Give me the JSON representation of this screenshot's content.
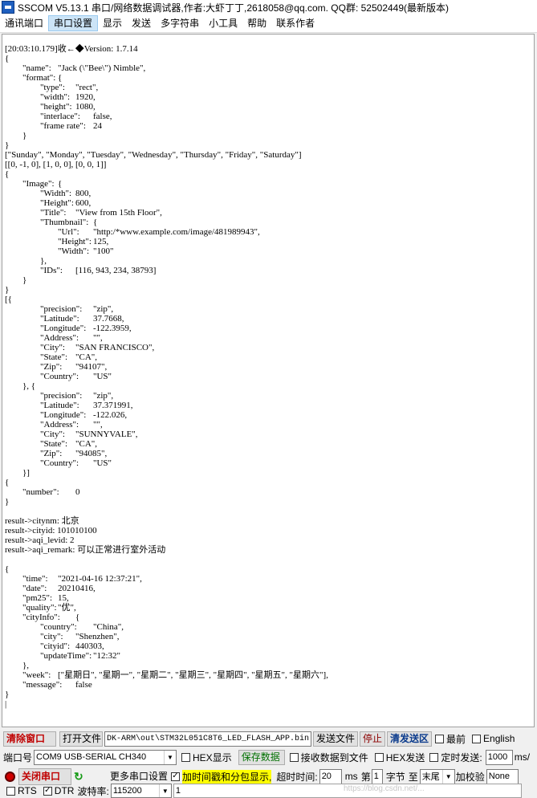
{
  "window": {
    "title": "SSCOM V5.13.1 串口/网络数据调试器,作者:大虾丁丁,2618058@qq.com. QQ群: 52502449(最新版本)"
  },
  "menu": [
    "通讯端口",
    "串口设置",
    "显示",
    "发送",
    "多字符串",
    "小工具",
    "帮助",
    "联系作者"
  ],
  "terminal": {
    "text": "[20:03:10.179]收←◆Version: 1.7.14\n{\n\t\"name\":\t\"Jack (\\\"Bee\\\") Nimble\",\n\t\"format\":\t{\n\t\t\"type\":\t\"rect\",\n\t\t\"width\":\t1920,\n\t\t\"height\":\t1080,\n\t\t\"interlace\":\tfalse,\n\t\t\"frame rate\":\t24\n\t}\n}\n[\"Sunday\", \"Monday\", \"Tuesday\", \"Wednesday\", \"Thursday\", \"Friday\", \"Saturday\"]\n[[0, -1, 0], [1, 0, 0], [0, 0, 1]]\n{\n\t\"Image\":\t{\n\t\t\"Width\":\t800,\n\t\t\"Height\":\t600,\n\t\t\"Title\":\t\"View from 15th Floor\",\n\t\t\"Thumbnail\":\t{\n\t\t\t\"Url\":\t\"http:/*www.example.com/image/481989943\",\n\t\t\t\"Height\":\t125,\n\t\t\t\"Width\":\t\"100\"\n\t\t},\n\t\t\"IDs\":\t[116, 943, 234, 38793]\n\t}\n}\n[{\n\t\t\"precision\":\t\"zip\",\n\t\t\"Latitude\":\t37.7668,\n\t\t\"Longitude\":\t-122.3959,\n\t\t\"Address\":\t\"\",\n\t\t\"City\":\t\"SAN FRANCISCO\",\n\t\t\"State\":\t\"CA\",\n\t\t\"Zip\":\t\"94107\",\n\t\t\"Country\":\t\"US\"\n\t}, {\n\t\t\"precision\":\t\"zip\",\n\t\t\"Latitude\":\t37.371991,\n\t\t\"Longitude\":\t-122.026,\n\t\t\"Address\":\t\"\",\n\t\t\"City\":\t\"SUNNYVALE\",\n\t\t\"State\":\t\"CA\",\n\t\t\"Zip\":\t\"94085\",\n\t\t\"Country\":\t\"US\"\n\t}]\n{\n\t\"number\":\t0\n}\n\nresult->citynm: 北京\nresult->cityid: 101010100\nresult->aqi_levid: 2\nresult->aqi_remark: 可以正常进行室外活动\n\n{\n\t\"time\":\t\"2021-04-16 12:37:21\",\n\t\"date\":\t20210416,\n\t\"pm25\":\t15,\n\t\"quality\":\t\"优\",\n\t\"cityInfo\":\t{\n\t\t\"country\":\t\"China\",\n\t\t\"city\":\t\"Shenzhen\",\n\t\t\"cityid\":\t440303,\n\t\t\"updateTime\":\t\"12:32\"\n\t},\n\t\"week\":\t[\"星期日\", \"星期一\", \"星期二\", \"星期三\", \"星期四\", \"星期五\", \"星期六\"],\n\t\"message\":\tfalse\n}\n|"
  },
  "toolbar1": {
    "clear_label": "清除窗口",
    "open_file_label": "打开文件",
    "file_path": "DK-ARM\\out\\STM32L051C8T6_LED_FLASH_APP.bin",
    "send_file_label": "发送文件",
    "stop_label": "停止",
    "clear_send_label": "清发送区",
    "topmost_label": "最前",
    "english_label": "English"
  },
  "toolbar2": {
    "port_label": "端口号",
    "port_value": "COM9 USB-SERIAL CH340",
    "hex_display_label": "HEX显示",
    "save_data_label": "保存数据",
    "receive_to_file_label": "接收数据到文件",
    "hex_send_label": "HEX发送",
    "timed_send_label": "定时发送:",
    "interval_value": "1000",
    "interval_unit": "ms/"
  },
  "toolbar3": {
    "close_port_label": "关闭串口",
    "more_settings_label": "更多串口设置",
    "timestamp_label": "加时间戳和分包显示,",
    "timeout_label": "超时时间:",
    "timeout_value": "20",
    "timeout_unit": "ms",
    "nth_label": "第",
    "byte_value": "1",
    "byte_label": "字节",
    "to_label": "至",
    "end_value": "末尾",
    "checksum_label": "加校验",
    "checksum_value": "None"
  },
  "toolbar4": {
    "rts_label": "RTS",
    "dtr_label": "DTR",
    "baud_label": "波特率:",
    "baud_value": "115200",
    "send_input_value": "1"
  },
  "watermark": "https://blog.csdn.net/..."
}
